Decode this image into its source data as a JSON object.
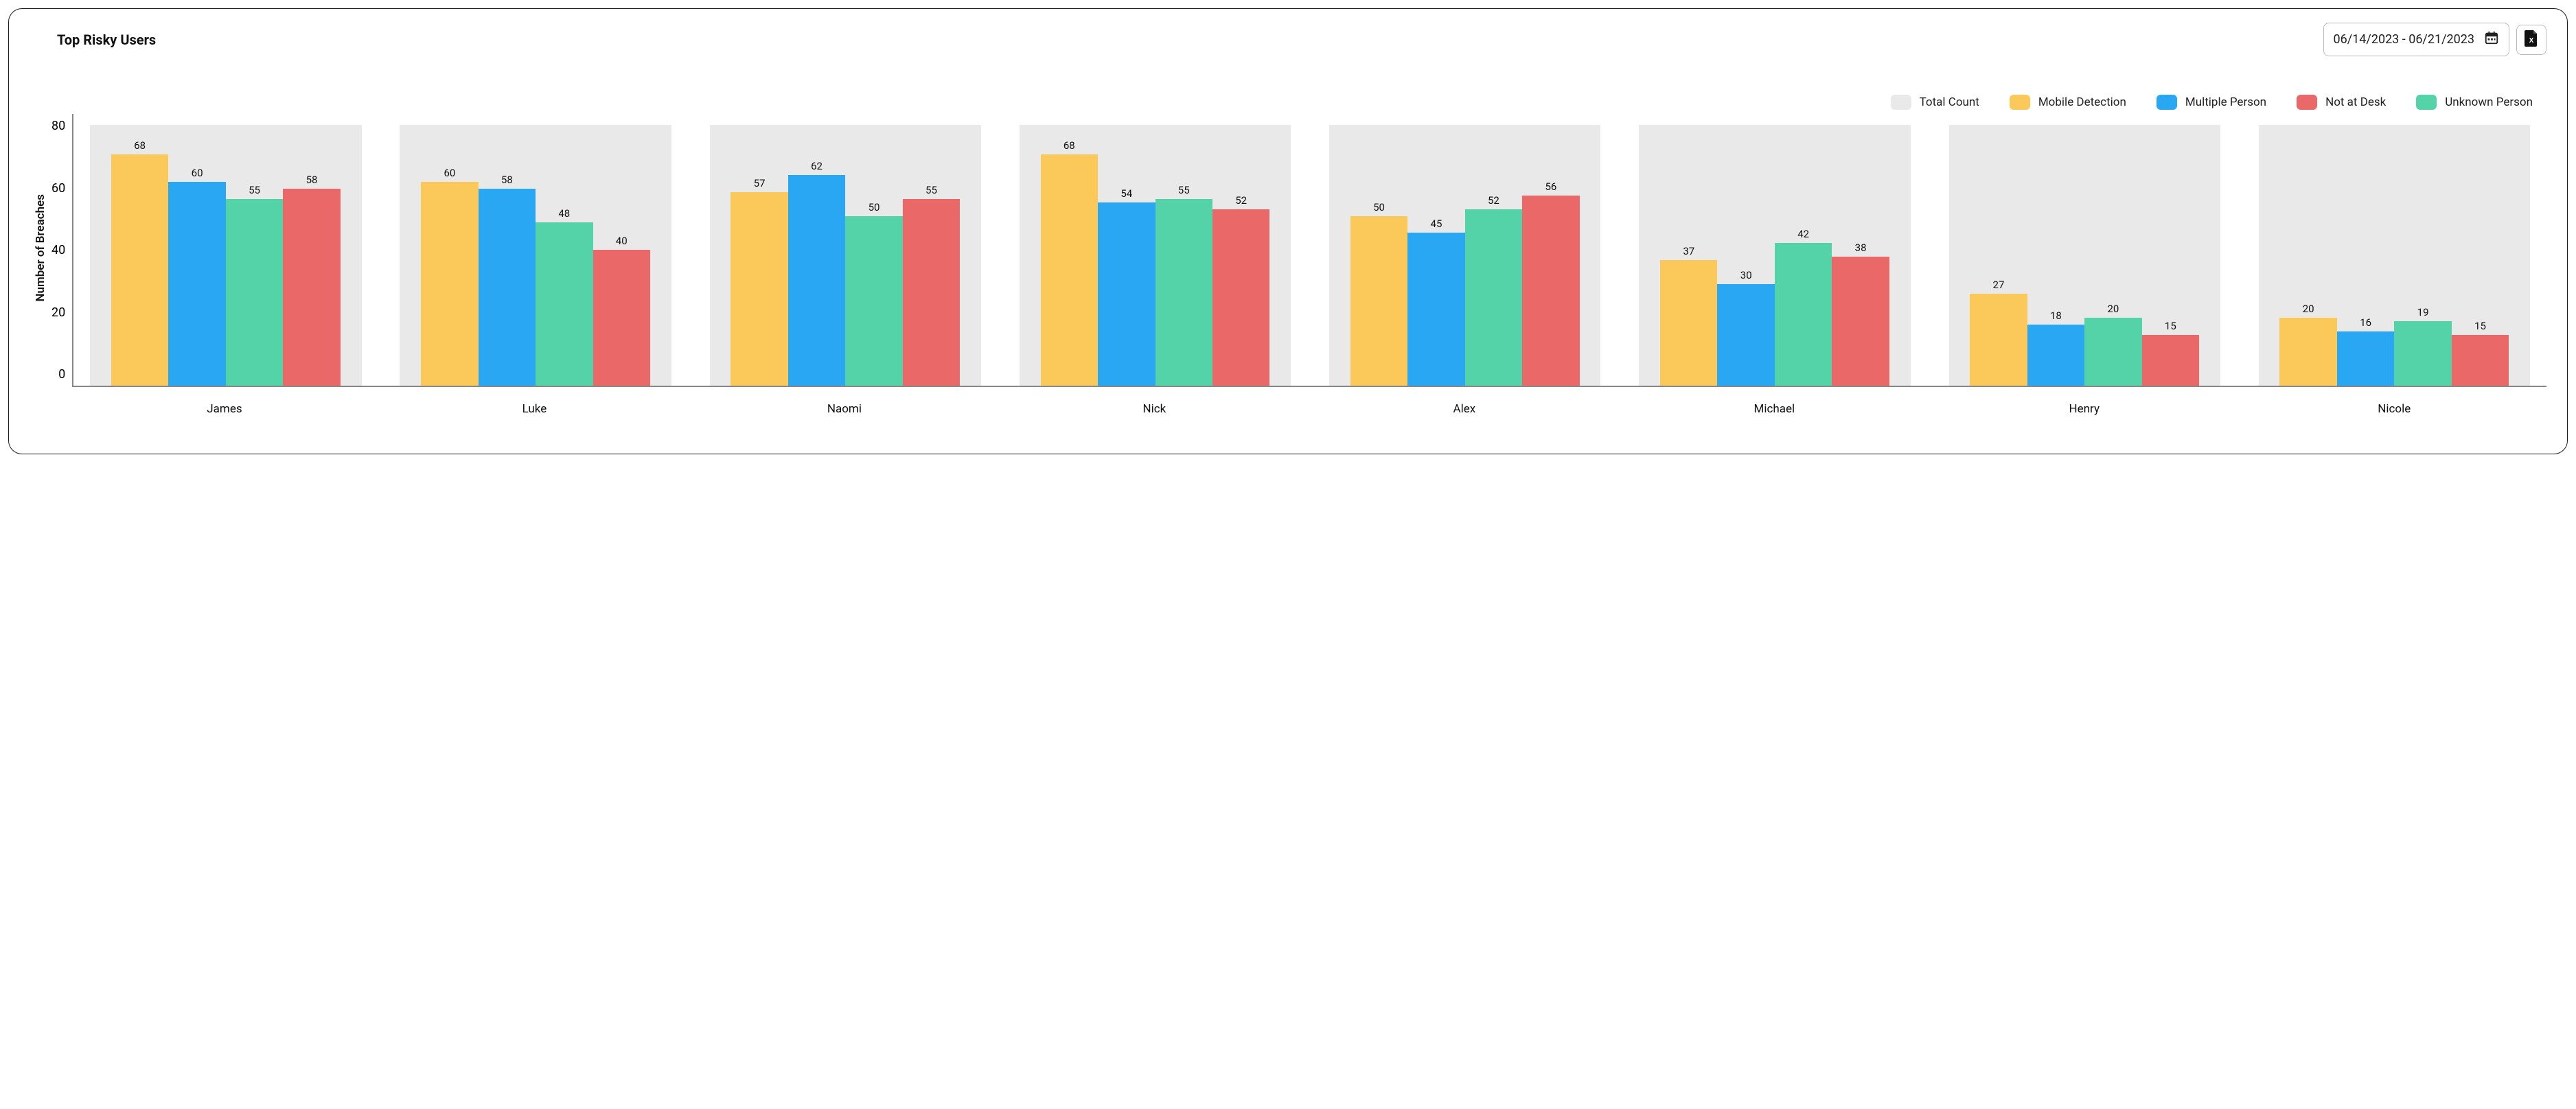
{
  "title": "Top Risky Users",
  "date_range": "06/14/2023 - 06/21/2023",
  "legend": {
    "total": "Total Count",
    "mobile": "Mobile Detection",
    "multiple": "Multiple Person",
    "notdesk": "Not at Desk",
    "unknown": "Unknown Person"
  },
  "colors": {
    "total": "#e9e9e9",
    "mobile": "#fbc95a",
    "multiple": "#29a7f3",
    "unknown": "#55d3a8",
    "notdesk": "#eb6869"
  },
  "ylabel": "Number of Breaches",
  "chart_data": {
    "type": "bar",
    "ylim": [
      0,
      80
    ],
    "yticks": [
      0,
      20,
      40,
      60,
      80
    ],
    "categories": [
      "James",
      "Luke",
      "Naomi",
      "Nick",
      "Alex",
      "Michael",
      "Henry",
      "Nicole"
    ],
    "total_height_pct": 96,
    "series": [
      {
        "name": "Mobile Detection",
        "color_key": "mobile",
        "values": [
          68,
          60,
          57,
          68,
          50,
          37,
          27,
          20
        ]
      },
      {
        "name": "Multiple Person",
        "color_key": "multiple",
        "values": [
          60,
          58,
          62,
          54,
          45,
          30,
          18,
          16
        ]
      },
      {
        "name": "Unknown Person",
        "color_key": "unknown",
        "values": [
          55,
          48,
          50,
          55,
          52,
          42,
          20,
          19
        ]
      },
      {
        "name": "Not at Desk",
        "color_key": "notdesk",
        "values": [
          58,
          40,
          55,
          52,
          56,
          38,
          15,
          15
        ]
      }
    ]
  }
}
